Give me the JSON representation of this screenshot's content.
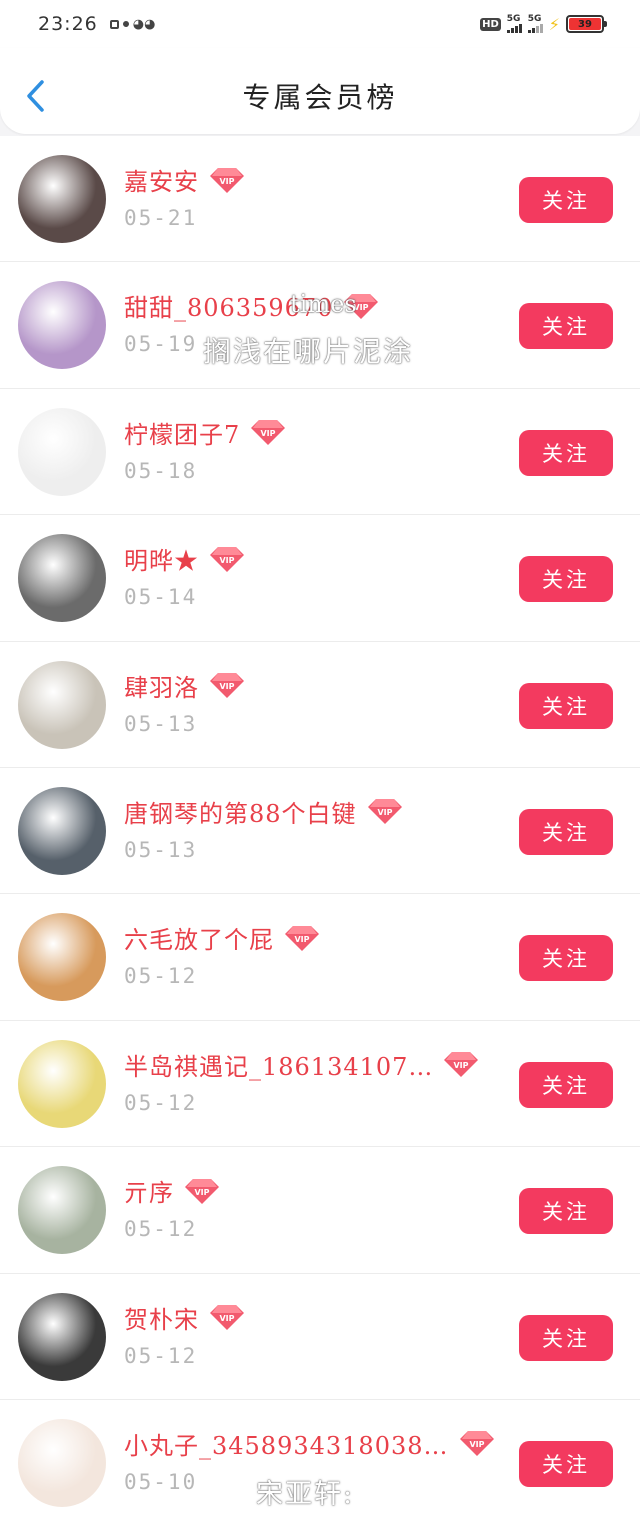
{
  "status_bar": {
    "time": "23:26",
    "hd_label": "HD",
    "net1": "5G",
    "net2": "5G",
    "battery": "39"
  },
  "header": {
    "title": "专属会员榜"
  },
  "follow_label": "关注",
  "vip_label": "VIP",
  "members": [
    {
      "name": "嘉安安",
      "date": "05-21",
      "badge": "vip",
      "avatar_color": "#5a4a48",
      "avatar_icon": "photo-avatar"
    },
    {
      "name": "甜甜_806359670",
      "date": "05-19",
      "badge": "vip",
      "avatar_color": "#b596c9",
      "avatar_icon": "anime-avatar"
    },
    {
      "name": "柠檬团子7",
      "date": "05-18",
      "badge": "vip",
      "avatar_color": "#eeeeee",
      "avatar_icon": "bunny-avatar"
    },
    {
      "name": "明晔★",
      "date": "05-14",
      "badge": "vip",
      "avatar_color": "#6b6b6b",
      "avatar_icon": "photo-avatar"
    },
    {
      "name": "肆羽洛",
      "date": "05-13",
      "badge": "vip",
      "avatar_color": "#c9c3b8",
      "avatar_icon": "anime-avatar"
    },
    {
      "name": "唐钢琴的第88个白键",
      "date": "05-13",
      "badge": "vip",
      "avatar_color": "#56606a",
      "avatar_icon": "photo-avatar"
    },
    {
      "name": "六毛放了个屁",
      "date": "05-12",
      "badge": "vip",
      "avatar_color": "#d79a5c",
      "avatar_icon": "cat-avatar"
    },
    {
      "name": "半岛祺遇记_186134107…",
      "date": "05-12",
      "badge": "vip",
      "avatar_color": "#e8d877",
      "avatar_icon": "chick-avatar"
    },
    {
      "name": "亓序",
      "date": "05-12",
      "badge": "vip",
      "avatar_color": "#a7b3a0",
      "avatar_icon": "photo-avatar"
    },
    {
      "name": "贺朴宋",
      "date": "05-12",
      "badge": "vip",
      "avatar_color": "#3a3a3a",
      "avatar_icon": "photo-avatar"
    },
    {
      "name": "小丸子_3458934318038…",
      "date": "05-10",
      "badge": "vip",
      "avatar_color": "#f3e6dd",
      "avatar_icon": "cartoon-avatar"
    }
  ],
  "watermarks": {
    "line1": "times",
    "line2": "搁浅在哪片泥涂",
    "line3": "宋亚轩:"
  },
  "colors": {
    "accent": "#f33a5f",
    "name_red": "#e8404a",
    "back_blue": "#2f8fe0",
    "vip_pink": "#f25a6e"
  }
}
